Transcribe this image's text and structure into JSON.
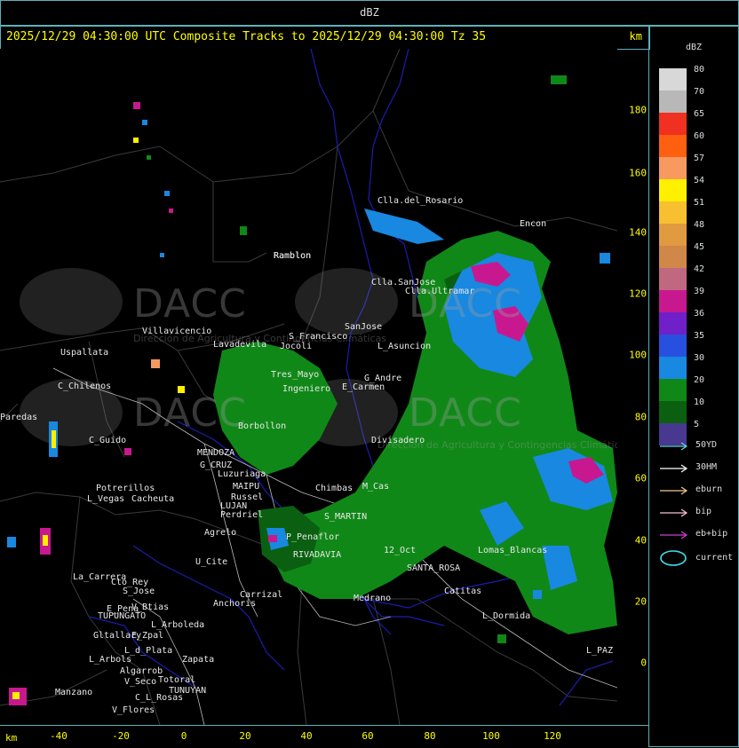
{
  "header": {
    "product": "dBZ",
    "title": "2025/12/29 04:30:00 UTC Composite Tracks to 2025/12/29 04:30:00 Tz 35",
    "km_label": "km"
  },
  "axes": {
    "x_ticks": [
      "-40",
      "-20",
      "0",
      "20",
      "40",
      "60",
      "80",
      "100",
      "120"
    ],
    "y_ticks": [
      "180",
      "160",
      "140",
      "120",
      "100",
      "80",
      "60",
      "40",
      "20",
      "0"
    ],
    "x_unit": "km",
    "y_unit": "km"
  },
  "legend": {
    "title": "dBZ",
    "levels": [
      {
        "label": "80",
        "color": "#d8d8d8"
      },
      {
        "label": "70",
        "color": "#b8b8b8"
      },
      {
        "label": "65",
        "color": "#f03020"
      },
      {
        "label": "60",
        "color": "#ff6010"
      },
      {
        "label": "57",
        "color": "#f89a60"
      },
      {
        "label": "54",
        "color": "#fff000"
      },
      {
        "label": "51",
        "color": "#f8c030"
      },
      {
        "label": "48",
        "color": "#e09a40"
      },
      {
        "label": "45",
        "color": "#d08848"
      },
      {
        "label": "42",
        "color": "#c06880"
      },
      {
        "label": "39",
        "color": "#c81890"
      },
      {
        "label": "36",
        "color": "#7020c8"
      },
      {
        "label": "35",
        "color": "#2850e0"
      },
      {
        "label": "30",
        "color": "#1888e0"
      },
      {
        "label": "20",
        "color": "#108818"
      },
      {
        "label": "10",
        "color": "#0a6010"
      },
      {
        "label": "5",
        "color": "#483890"
      }
    ],
    "tracks": [
      {
        "label": "50YD",
        "color": "#60d8e0"
      },
      {
        "label": "30HM",
        "color": "#ffffff"
      },
      {
        "label": "eburn",
        "color": "#f0c890"
      },
      {
        "label": "bip",
        "color": "#f8c0d8"
      },
      {
        "label": "eb+bip",
        "color": "#d040d0"
      }
    ],
    "current": {
      "label": "current",
      "color": "#40e0f0"
    }
  },
  "watermark": {
    "text": "DACC",
    "subtitle": "Dirección de Agricultura y Contingencias Climáticas"
  },
  "places": [
    {
      "name": "Clla.del_Rosario"
    },
    {
      "name": "Encon"
    },
    {
      "name": "Ramblon"
    },
    {
      "name": "Clla.SanJose"
    },
    {
      "name": "Clla.Ultramar"
    },
    {
      "name": "S_Francisco"
    },
    {
      "name": "SanJose"
    },
    {
      "name": "Villavicencio"
    },
    {
      "name": "Uspallata"
    },
    {
      "name": "Jocoli"
    },
    {
      "name": "Lavadevila"
    },
    {
      "name": "L_Asuncion"
    },
    {
      "name": "C_Chilenos"
    },
    {
      "name": "Tres_Mayo"
    },
    {
      "name": "Ingeniero"
    },
    {
      "name": "E_Carmen"
    },
    {
      "name": "G_Andre"
    },
    {
      "name": "Paredas"
    },
    {
      "name": "Borbollon"
    },
    {
      "name": "Divisadero"
    },
    {
      "name": "C_Guido"
    },
    {
      "name": "MENDOZA"
    },
    {
      "name": "G_CRUZ"
    },
    {
      "name": "Luzuriaga"
    },
    {
      "name": "MAIPU"
    },
    {
      "name": "Potrerillos"
    },
    {
      "name": "Cacheuta"
    },
    {
      "name": "L_Vegas"
    },
    {
      "name": "LUJAN"
    },
    {
      "name": "Russel"
    },
    {
      "name": "Perdriel"
    },
    {
      "name": "Chimbas"
    },
    {
      "name": "M_Cas"
    },
    {
      "name": "S_MARTIN"
    },
    {
      "name": "Agrelo"
    },
    {
      "name": "P_Penaflor"
    },
    {
      "name": "RIVADAVIA"
    },
    {
      "name": "U_Cite"
    },
    {
      "name": "La_Carrera"
    },
    {
      "name": "Cto_Rey"
    },
    {
      "name": "S_Jose"
    },
    {
      "name": "Lomas_Blancas"
    },
    {
      "name": "SANTA_ROSA"
    },
    {
      "name": "Carrizal"
    },
    {
      "name": "Anchoris"
    },
    {
      "name": "E_Pena"
    },
    {
      "name": "TUPUNGATO"
    },
    {
      "name": "V_Btias"
    },
    {
      "name": "L_Arboleda"
    },
    {
      "name": "Gltallary"
    },
    {
      "name": "E_Zpal"
    },
    {
      "name": "L_d_Plata"
    },
    {
      "name": "Catitas"
    },
    {
      "name": "L_Dormida"
    },
    {
      "name": "L_Arbols"
    },
    {
      "name": "Zapata"
    },
    {
      "name": "Algarrob"
    },
    {
      "name": "V_Seco"
    },
    {
      "name": "Totoral"
    },
    {
      "name": "TUNUYAN"
    },
    {
      "name": "Manzano"
    },
    {
      "name": "C_L_Rosas"
    },
    {
      "name": "V_Flores"
    },
    {
      "name": "L_PAZ"
    },
    {
      "name": "Medrano"
    },
    {
      "name": "12_Oct"
    },
    {
      "name": "Ramblon"
    }
  ]
}
